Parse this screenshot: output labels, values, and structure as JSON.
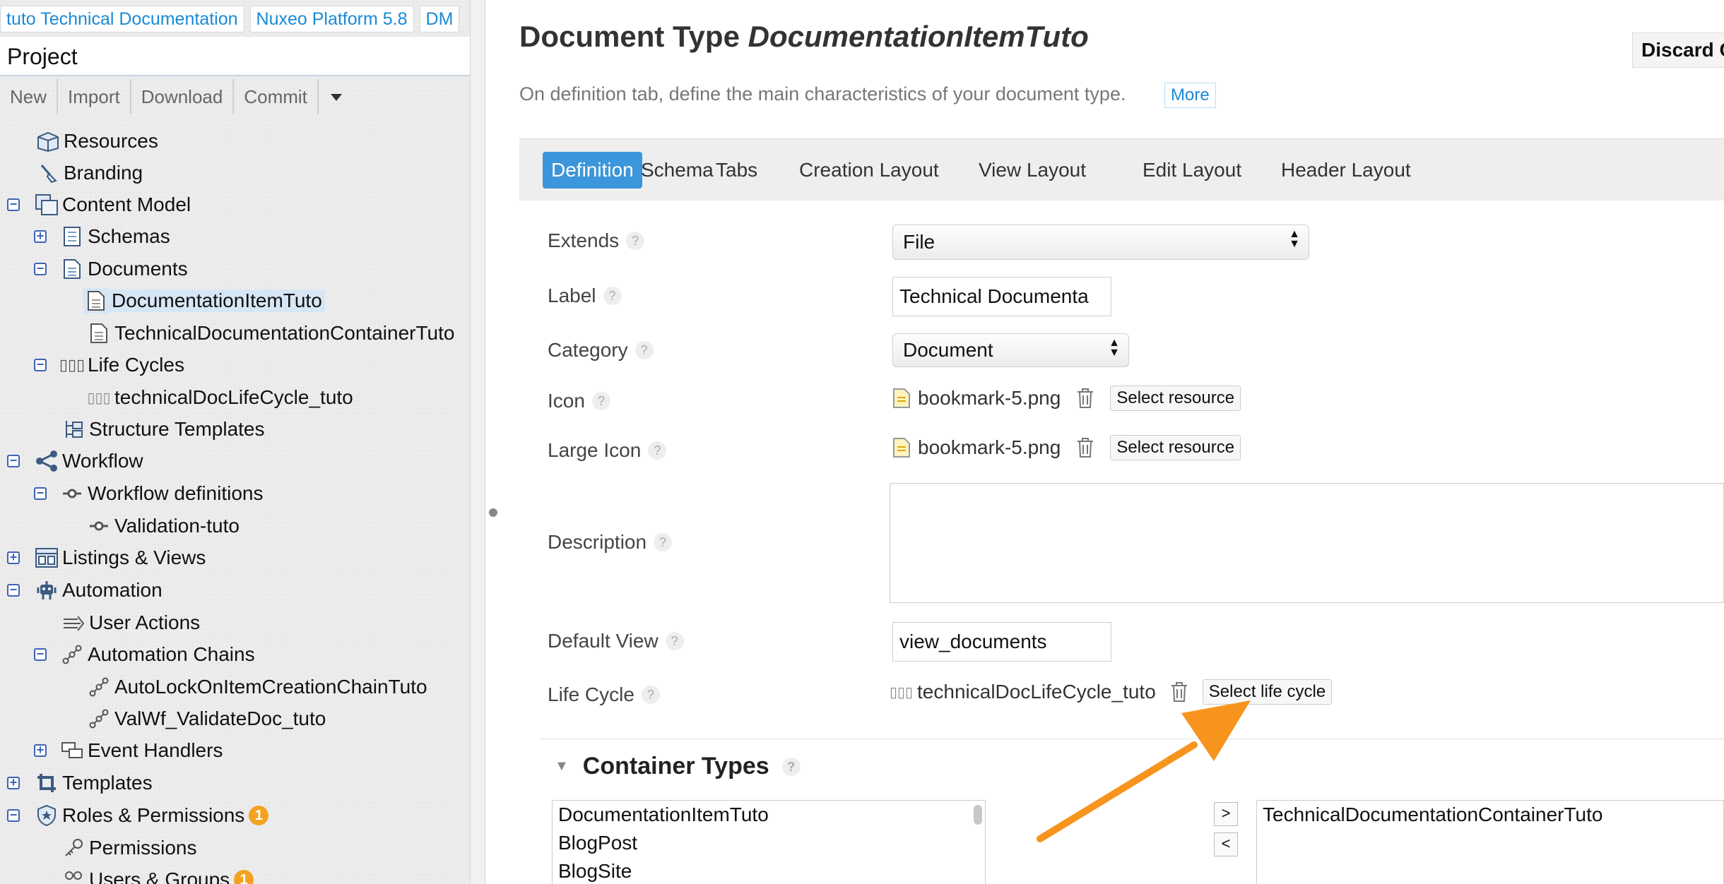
{
  "crumbs": [
    "tuto Technical Documentation",
    "Nuxeo Platform 5.8",
    "DM"
  ],
  "project": "Project",
  "toolbar": [
    "New",
    "Import",
    "Download",
    "Commit"
  ],
  "tree": {
    "resources": "Resources",
    "branding": "Branding",
    "content_model": "Content Model",
    "schemas": "Schemas",
    "documents": "Documents",
    "doc_item": "DocumentationItemTuto",
    "doc_container": "TechnicalDocumentationContainerTuto",
    "life_cycles": "Life Cycles",
    "lifecycle_item": "technicalDocLifeCycle_tuto",
    "structure_templates": "Structure Templates",
    "workflow": "Workflow",
    "workflow_definitions": "Workflow definitions",
    "validation_tuto": "Validation-tuto",
    "listings_views": "Listings & Views",
    "automation": "Automation",
    "user_actions": "User Actions",
    "automation_chains": "Automation Chains",
    "chain1": "AutoLockOnItemCreationChainTuto",
    "chain2": "ValWf_ValidateDoc_tuto",
    "event_handlers": "Event Handlers",
    "templates": "Templates",
    "roles_permissions": "Roles & Permissions",
    "roles_badge": "1",
    "permissions": "Permissions",
    "users_groups": "Users & Groups",
    "users_badge": "1"
  },
  "main": {
    "title_prefix": "Document Type",
    "title_name": "DocumentationItemTuto",
    "discard": "Discard C",
    "description": "On definition tab, define the main characteristics of your document type.",
    "more": "More",
    "tabs": [
      "Definition",
      "Schema",
      "Tabs",
      "Creation Layout",
      "View Layout",
      "Edit Layout",
      "Header Layout"
    ]
  },
  "form": {
    "extends_label": "Extends",
    "extends_value": "File",
    "label_label": "Label",
    "label_value": "Technical Documenta",
    "category_label": "Category",
    "category_value": "Document",
    "icon_label": "Icon",
    "icon_file": "bookmark-5.png",
    "large_icon_label": "Large Icon",
    "large_icon_file": "bookmark-5.png",
    "select_resource": "Select resource",
    "description_label": "Description",
    "default_view_label": "Default View",
    "default_view_value": "view_documents",
    "life_cycle_label": "Life Cycle",
    "life_cycle_value": "technicalDocLifeCycle_tuto",
    "select_life_cycle": "Select life cycle",
    "help": "?"
  },
  "container_types": {
    "title": "Container Types",
    "available": [
      "DocumentationItemTuto",
      "BlogPost",
      "BlogSite"
    ],
    "selected": [
      "TechnicalDocumentationContainerTuto"
    ],
    "add": ">",
    "remove": "<"
  },
  "colors": {
    "accent": "#3b96db",
    "annotation_arrow": "#f7941d",
    "badge": "#f3a21f",
    "tree_toggle": "#3d63b4"
  }
}
